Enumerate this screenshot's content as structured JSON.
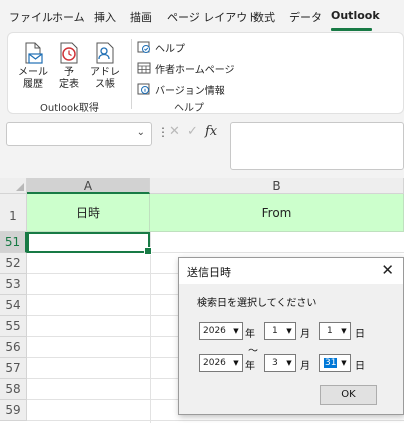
{
  "ribbon_tabs": [
    "ファイル",
    "ホーム",
    "挿入",
    "描画",
    "ページ レイアウト",
    "数式",
    "データ",
    "Outlook"
  ],
  "active_tab": "Outlook",
  "accent_color": "#187a45",
  "ribbon": {
    "outlook_group": {
      "label": "Outlook取得",
      "buttons": [
        {
          "label_line1": "メール",
          "label_line2": "履歴",
          "icon": "mail-document-icon"
        },
        {
          "label_line1": "予",
          "label_line2": "定表",
          "icon": "clock-icon"
        },
        {
          "label_line1": "アドレ",
          "label_line2": "ス帳",
          "icon": "address-book-icon"
        }
      ]
    },
    "help_group": {
      "label": "ヘルプ",
      "buttons": [
        {
          "label": "ヘルプ",
          "icon": "help-icon"
        },
        {
          "label": "作者ホームページ",
          "icon": "web-page-icon"
        },
        {
          "label": "バージョン情報",
          "icon": "version-info-icon"
        }
      ]
    }
  },
  "formula_bar": {
    "name_box_value": "",
    "fx_label": "fx",
    "formula_value": ""
  },
  "sheet": {
    "columns": [
      "A",
      "B"
    ],
    "header_row": {
      "row_number": "1",
      "cells": [
        "日時",
        "From"
      ],
      "fill_color": "#ccffcc"
    },
    "row_numbers": [
      "51",
      "52",
      "53",
      "54",
      "55",
      "56",
      "57",
      "58",
      "59"
    ],
    "selected_cell": "A51"
  },
  "dialog": {
    "title": "送信日時",
    "instruction": "検索日を選択してください",
    "from": {
      "year": "2026",
      "month": "1",
      "day": "1"
    },
    "to": {
      "year": "2026",
      "month": "3",
      "day": "31"
    },
    "year_unit": "年",
    "month_unit": "月",
    "day_unit": "日",
    "separator": "～",
    "ok_label": "OK"
  }
}
